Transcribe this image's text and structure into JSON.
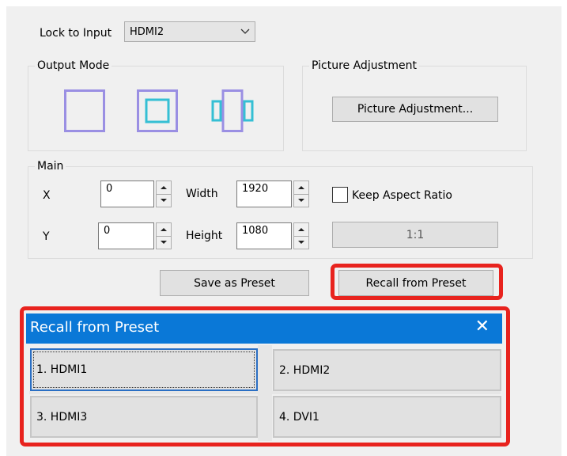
{
  "lock": {
    "label": "Lock to Input",
    "value": "HDMI2"
  },
  "output_mode": {
    "title": "Output Mode",
    "icons": [
      "single-window-icon",
      "picture-in-picture-icon",
      "side-by-side-icon"
    ]
  },
  "picture_adjustment": {
    "title": "Picture Adjustment",
    "button": "Picture Adjustment..."
  },
  "main": {
    "title": "Main",
    "x_label": "X",
    "x_value": "0",
    "y_label": "Y",
    "y_value": "0",
    "width_label": "Width",
    "width_value": "1920",
    "height_label": "Height",
    "height_value": "1080",
    "keep_aspect_label": "Keep Aspect Ratio",
    "ratio_button": "1:1"
  },
  "buttons": {
    "save_preset": "Save as Preset",
    "recall_preset": "Recall from Preset"
  },
  "dialog": {
    "title": "Recall from Preset",
    "close": "✕",
    "presets": [
      "1. HDMI1",
      "2. HDMI2",
      "3. HDMI3",
      "4. DVI1"
    ]
  },
  "colors": {
    "mode_icon_outer": "#9a8fe3",
    "mode_icon_inner": "#35bfd4",
    "title_bar": "#0a78d7",
    "highlight": "#e8231e"
  }
}
